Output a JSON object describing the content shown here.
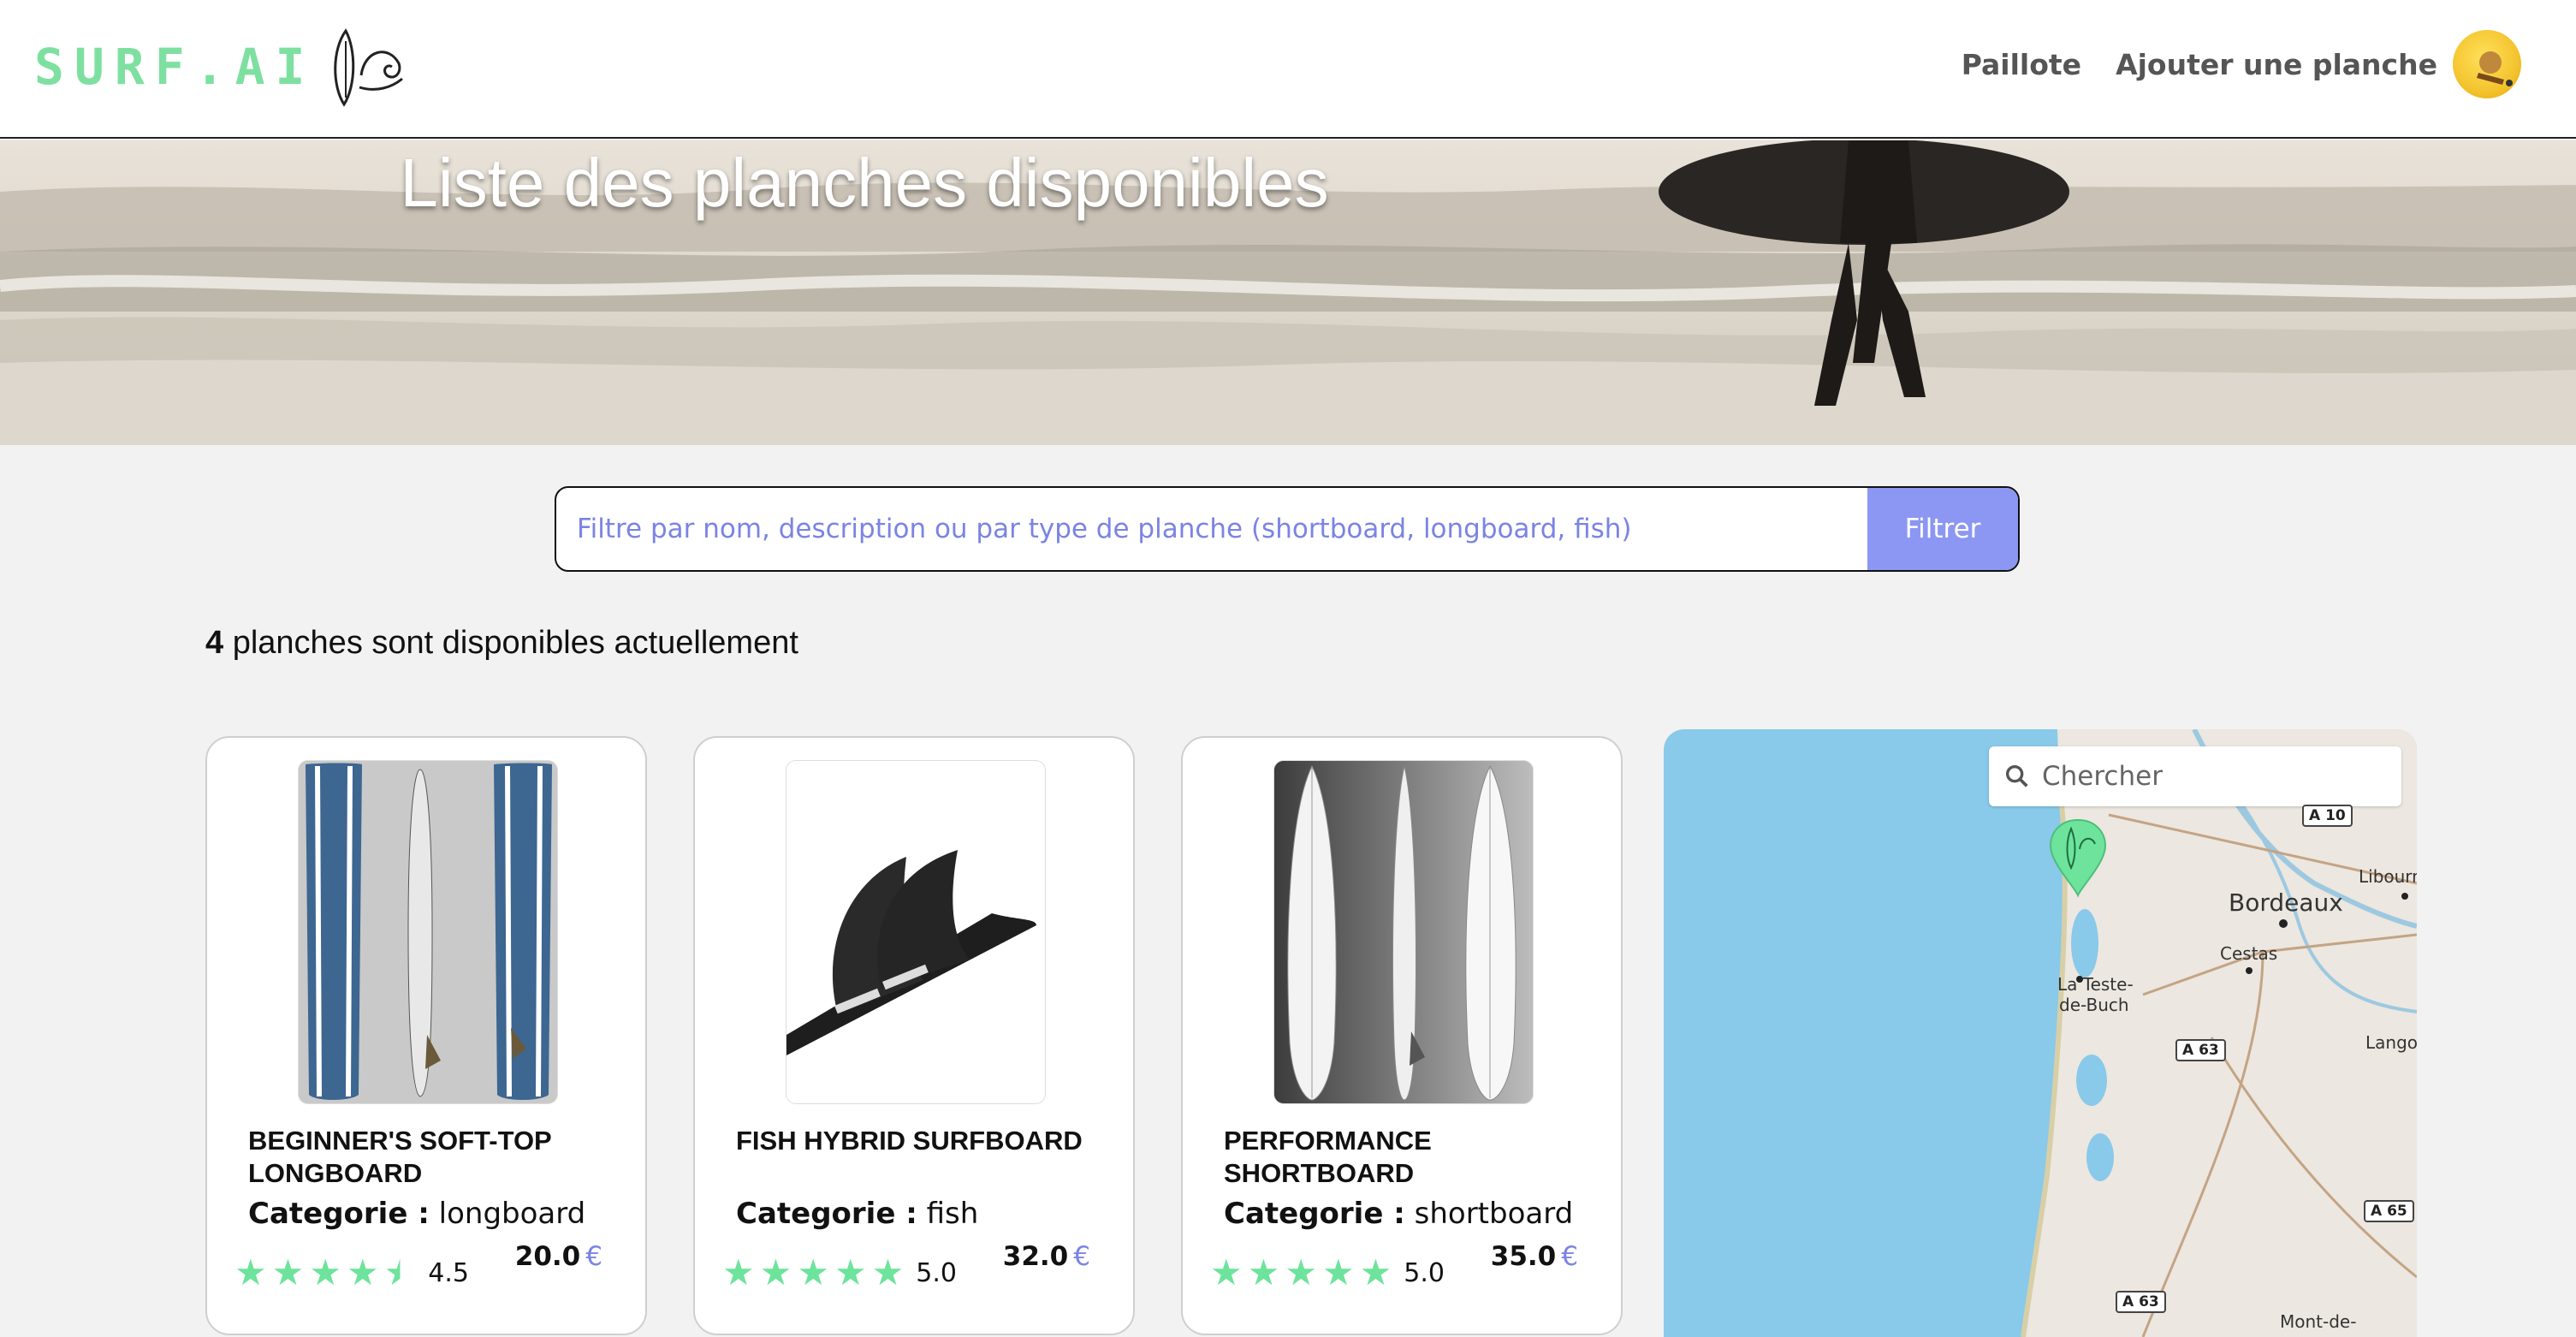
{
  "nav": {
    "logo_text": "SURF.AI",
    "links": [
      "Paillote",
      "Ajouter une planche"
    ]
  },
  "hero": {
    "title": "Liste des planches disponibles"
  },
  "search": {
    "placeholder": "Filtre par nom, description ou par type de planche (shortboard, longboard, fish)",
    "button": "Filtrer"
  },
  "count": {
    "number": "4",
    "text": "planches sont disponibles actuellement"
  },
  "cards": [
    {
      "name": "Beginner's Soft-Top Longboard",
      "category_label": "Categorie :",
      "category": "longboard",
      "rating": "4.5",
      "rating_value": 4.5,
      "price": "20.0",
      "currency": "€"
    },
    {
      "name": "Fish Hybrid Surfboard",
      "category_label": "Categorie :",
      "category": "fish",
      "rating": "5.0",
      "rating_value": 5,
      "price": "32.0",
      "currency": "€"
    },
    {
      "name": "Performance Shortboard",
      "category_label": "Categorie :",
      "category": "shortboard",
      "rating": "5.0",
      "rating_value": 5,
      "price": "35.0",
      "currency": "€"
    }
  ],
  "map": {
    "search_placeholder": "Chercher",
    "labels": [
      "Bordeaux",
      "Cestas",
      "La Teste-",
      "de-Buch",
      "Libourn",
      "Lango",
      "Mont-de-"
    ],
    "roads": [
      "A 10",
      "A 63",
      "A 65",
      "A 63"
    ]
  },
  "colors": {
    "accent": "#8b97f2",
    "star": "#6ee39c",
    "logo": "#7ee0a0",
    "sea": "#89c9ea"
  }
}
